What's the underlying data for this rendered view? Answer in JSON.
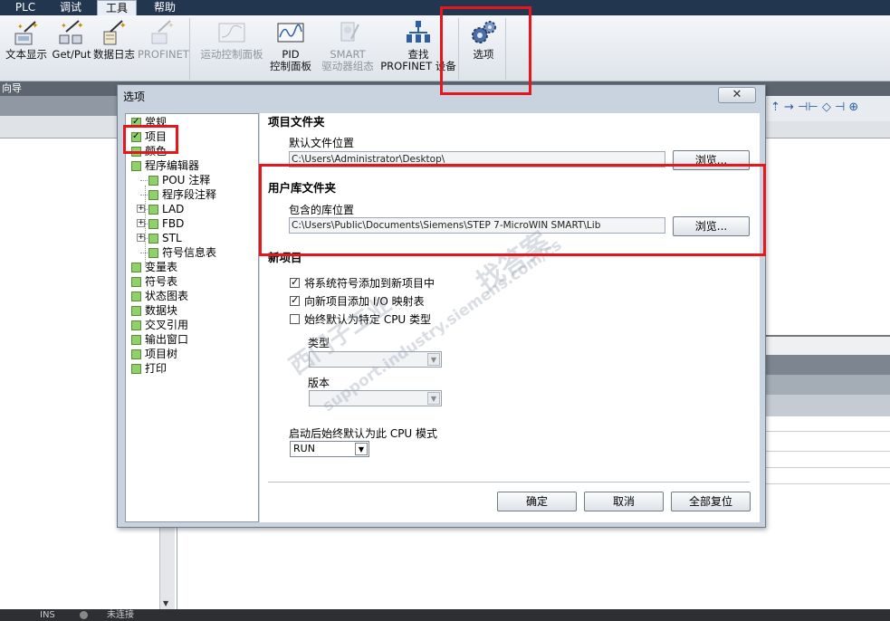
{
  "menu": {
    "items": [
      "PLC",
      "调试",
      "工具",
      "帮助"
    ],
    "active_index": 2
  },
  "ribbon": {
    "buttons": [
      {
        "label_line1": "文本显示",
        "label_line2": "",
        "icon": "text-display-wand-icon",
        "enabled": true
      },
      {
        "label_line1": "Get/Put",
        "label_line2": "",
        "icon": "get-put-wand-icon",
        "enabled": true
      },
      {
        "label_line1": "数据日志",
        "label_line2": "",
        "icon": "data-log-wand-icon",
        "enabled": true
      },
      {
        "label_line1": "PROFINET",
        "label_line2": "",
        "icon": "profinet-wand-icon",
        "enabled": false
      },
      {
        "label_line1": "运动控制面板",
        "label_line2": "",
        "icon": "motion-panel-icon",
        "enabled": false
      },
      {
        "label_line1": "PID",
        "label_line2": "控制面板",
        "icon": "pid-panel-icon",
        "enabled": true
      },
      {
        "label_line1": "SMART",
        "label_line2": "驱动器组态",
        "icon": "smart-drive-icon",
        "enabled": false
      },
      {
        "label_line1": "查找",
        "label_line2": "PROFINET 设备",
        "icon": "find-profinet-icon",
        "enabled": true
      },
      {
        "label_line1": "选项",
        "label_line2": "",
        "icon": "options-gears-icon",
        "enabled": true
      }
    ]
  },
  "subbar": {
    "label": "向导"
  },
  "dialog": {
    "title": "选项",
    "close_glyph": "✕",
    "tree": [
      {
        "label": "常规",
        "checked": true,
        "level": 0
      },
      {
        "label": "项目",
        "checked": true,
        "level": 0
      },
      {
        "label": "颜色",
        "checked": false,
        "level": 0
      },
      {
        "label": "程序编辑器",
        "checked": false,
        "level": 0
      },
      {
        "label": "POU 注释",
        "checked": false,
        "level": 1
      },
      {
        "label": "程序段注释",
        "checked": false,
        "level": 1
      },
      {
        "label": "LAD",
        "checked": false,
        "level": 1,
        "expandable": true
      },
      {
        "label": "FBD",
        "checked": false,
        "level": 1,
        "expandable": true
      },
      {
        "label": "STL",
        "checked": false,
        "level": 1,
        "expandable": true
      },
      {
        "label": "符号信息表",
        "checked": false,
        "level": 1
      },
      {
        "label": "变量表",
        "checked": false,
        "level": 0
      },
      {
        "label": "符号表",
        "checked": false,
        "level": 0
      },
      {
        "label": "状态图表",
        "checked": false,
        "level": 0
      },
      {
        "label": "数据块",
        "checked": false,
        "level": 0
      },
      {
        "label": "交叉引用",
        "checked": false,
        "level": 0
      },
      {
        "label": "输出窗口",
        "checked": false,
        "level": 0
      },
      {
        "label": "项目树",
        "checked": false,
        "level": 0
      },
      {
        "label": "打印",
        "checked": false,
        "level": 0
      }
    ],
    "project_folder": {
      "heading": "项目文件夹",
      "default_label": "默认文件位置",
      "default_path": "C:\\Users\\Administrator\\Desktop\\",
      "browse": "浏览..."
    },
    "library_folder": {
      "heading": "用户库文件夹",
      "include_label": "包含的库位置",
      "include_path": "C:\\Users\\Public\\Documents\\Siemens\\STEP 7-MicroWIN SMART\\Lib",
      "browse": "浏览..."
    },
    "new_project": {
      "heading": "新项目",
      "options": [
        {
          "label": "将系统符号添加到新项目中",
          "checked": true
        },
        {
          "label": "向新项目添加 I/O 映射表",
          "checked": true
        },
        {
          "label": "始终默认为特定 CPU 类型",
          "checked": false
        }
      ],
      "type_label": "类型",
      "version_label": "版本",
      "mode_label": "启动后始终默认为此 CPU 模式",
      "mode_value": "RUN"
    },
    "buttons": {
      "ok": "确定",
      "cancel": "取消",
      "reset_all": "全部复位"
    }
  },
  "watermark": {
    "line1": "西门子工业",
    "line2": "support.industry.siemens.com/cs",
    "line3": "找答案"
  },
  "status": {
    "left": "INS",
    "conn": "未连接"
  }
}
